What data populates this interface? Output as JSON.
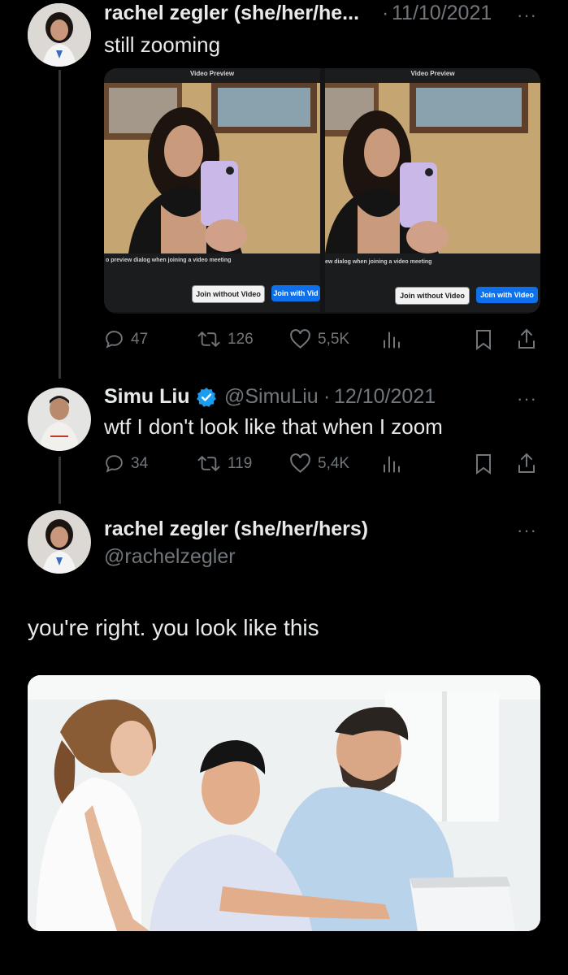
{
  "tweet1": {
    "display_name": "rachel zegler (she/her/he...",
    "separator": "·",
    "date": "11/10/2021",
    "more": "···",
    "text": "still zooming",
    "media": {
      "left": {
        "title": "Video Preview",
        "caption": "o preview dialog when joining a video meeting",
        "btn_without": "Join without Video",
        "btn_with": "Join with Vid"
      },
      "right": {
        "title": "Video Preview",
        "caption": "ew dialog when joining a video meeting",
        "btn_without": "Join without Video",
        "btn_with": "Join with Video"
      }
    },
    "actions": {
      "replies": "47",
      "reposts": "126",
      "likes": "5,5K"
    }
  },
  "tweet2": {
    "display_name": "Simu Liu",
    "handle": "@SimuLiu",
    "separator": "·",
    "date": "12/10/2021",
    "more": "···",
    "text": "wtf I don't look like that when I zoom",
    "actions": {
      "replies": "34",
      "reposts": "119",
      "likes": "5,4K"
    }
  },
  "tweet3": {
    "display_name": "rachel zegler (she/her/hers)",
    "handle": "@rachelzegler",
    "more": "···",
    "text": "you're right. you look like this"
  },
  "colors": {
    "background": "#000000",
    "text": "#e7e9ea",
    "muted": "#71767b",
    "verified": "#1d9bf0",
    "thread_line": "#333639"
  }
}
